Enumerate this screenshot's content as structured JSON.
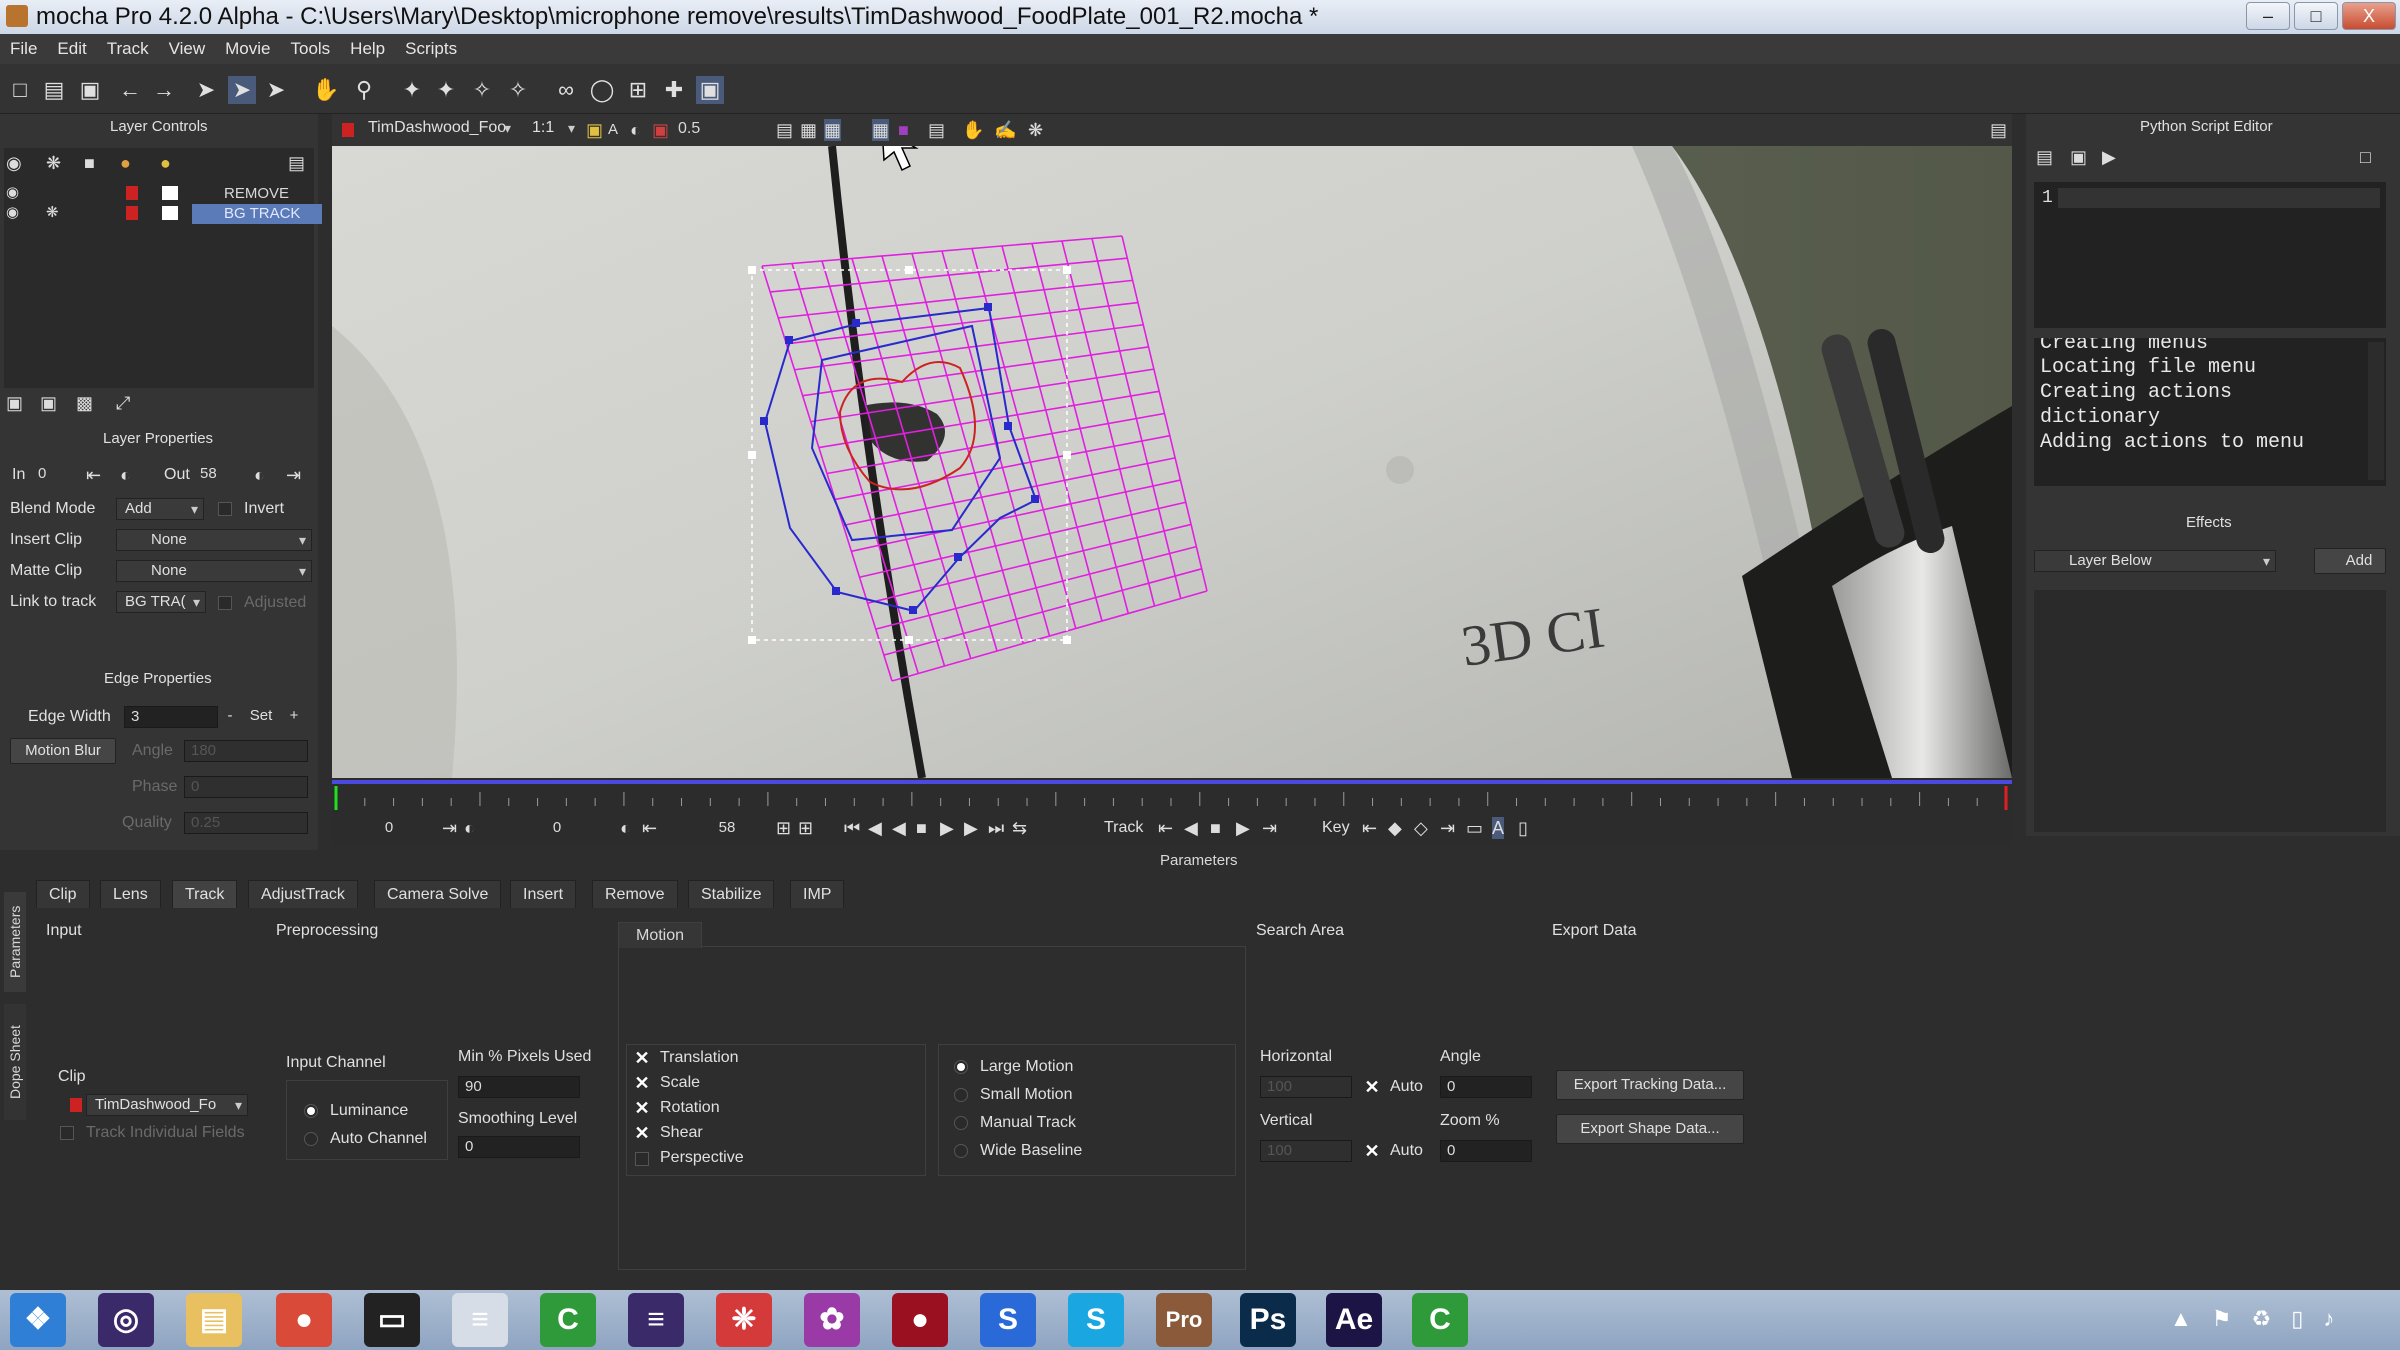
{
  "window": {
    "title": "mocha Pro 4.2.0 Alpha - C:\\Users\\Mary\\Desktop\\microphone remove\\results\\TimDashwood_FoodPlate_001_R2.mocha *",
    "minimize": "–",
    "maximize": "□",
    "close": "X"
  },
  "menu": [
    "File",
    "Edit",
    "Track",
    "View",
    "Movie",
    "Tools",
    "Help",
    "Scripts"
  ],
  "layer_controls": {
    "title": "Layer Controls",
    "layers": [
      {
        "name": "REMOVE",
        "selected": false
      },
      {
        "name": "BG TRACK",
        "selected": true
      }
    ]
  },
  "layer_properties": {
    "title": "Layer Properties",
    "in_label": "In",
    "in_value": "0",
    "out_label": "Out",
    "out_value": "58",
    "blend_mode_label": "Blend Mode",
    "blend_mode_value": "Add",
    "invert_label": "Invert",
    "insert_clip_label": "Insert Clip",
    "insert_clip_value": "None",
    "matte_clip_label": "Matte Clip",
    "matte_clip_value": "None",
    "link_to_track_label": "Link to track",
    "link_to_track_value": "BG TRA(",
    "adjusted_label": "Adjusted"
  },
  "edge_properties": {
    "title": "Edge Properties",
    "edge_width_label": "Edge Width",
    "edge_width_value": "3",
    "minus": "-",
    "set": "Set",
    "plus": "+",
    "motion_blur": "Motion Blur",
    "angle_label": "Angle",
    "angle_value": "180",
    "phase_label": "Phase",
    "phase_value": "0",
    "quality_label": "Quality",
    "quality_value": "0.25"
  },
  "viewer": {
    "clip_name": "TimDashwood_Foo",
    "zoom": "1:1",
    "opacity": "0.5",
    "shirt_text": "3D CI"
  },
  "timeline": {
    "start": "0",
    "current": "0",
    "end": "58",
    "track_label": "Track",
    "key_label": "Key"
  },
  "python_editor": {
    "title": "Python Script Editor",
    "line_number": "1",
    "console_lines": [
      "Creating menus",
      "Locating file menu",
      "Creating actions",
      "dictionary",
      "Adding actions to menu"
    ]
  },
  "effects": {
    "title": "Effects",
    "layer_value": "Layer Below",
    "add": "Add"
  },
  "parameters": {
    "title": "Parameters",
    "side_tabs": [
      "Parameters",
      "Dope Sheet"
    ],
    "tabs": [
      "Clip",
      "Lens",
      "Track",
      "AdjustTrack",
      "Camera Solve",
      "Insert",
      "Remove",
      "Stabilize",
      "IMP"
    ],
    "active_tab": "Track",
    "input": {
      "title": "Input",
      "clip_label": "Clip",
      "clip_value": "TimDashwood_Fo",
      "track_individual_fields": "Track Individual Fields"
    },
    "preprocessing": {
      "title": "Preprocessing",
      "input_channel_label": "Input Channel",
      "luminance": "Luminance",
      "auto_channel": "Auto Channel",
      "min_pixels_label": "Min % Pixels Used",
      "min_pixels_value": "90",
      "smoothing_label": "Smoothing Level",
      "smoothing_value": "0"
    },
    "motion": {
      "title": "Motion",
      "options": [
        {
          "label": "Translation",
          "checked": true
        },
        {
          "label": "Scale",
          "checked": true
        },
        {
          "label": "Rotation",
          "checked": true
        },
        {
          "label": "Shear",
          "checked": true
        },
        {
          "label": "Perspective",
          "checked": false
        }
      ],
      "modes": [
        {
          "label": "Large Motion",
          "selected": true
        },
        {
          "label": "Small Motion",
          "selected": false
        },
        {
          "label": "Manual Track",
          "selected": false
        },
        {
          "label": "Wide Baseline",
          "selected": false
        }
      ]
    },
    "search_area": {
      "title": "Search Area",
      "horizontal_label": "Horizontal",
      "horizontal_value": "100",
      "vertical_label": "Vertical",
      "vertical_value": "100",
      "auto_label": "Auto",
      "angle_label": "Angle",
      "angle_value": "0",
      "zoom_label": "Zoom %",
      "zoom_value": "0"
    },
    "export_data": {
      "title": "Export Data",
      "export_tracking": "Export Tracking Data...",
      "export_shape": "Export Shape Data..."
    }
  },
  "taskbar": {
    "apps": [
      {
        "name": "start",
        "glyph": "❖",
        "color": "#2f7fd6"
      },
      {
        "name": "app-viewer",
        "glyph": "◎",
        "color": "#3b2a6a"
      },
      {
        "name": "explorer",
        "glyph": "▤",
        "color": "#e8c060"
      },
      {
        "name": "chrome",
        "glyph": "●",
        "color": "#d94a38"
      },
      {
        "name": "terminal",
        "glyph": "▭",
        "color": "#222222"
      },
      {
        "name": "notepad",
        "glyph": "≡",
        "color": "#d7dde6"
      },
      {
        "name": "camtasia",
        "glyph": "C",
        "color": "#2e9a3a"
      },
      {
        "name": "premiere",
        "glyph": "≡",
        "color": "#3a2a6a"
      },
      {
        "name": "davinci",
        "glyph": "❈",
        "color": "#d53a3a"
      },
      {
        "name": "motion",
        "glyph": "✿",
        "color": "#9a3aa6"
      },
      {
        "name": "obs",
        "glyph": "●",
        "color": "#9a1020"
      },
      {
        "name": "sketchbook",
        "glyph": "S",
        "color": "#2a6ad8"
      },
      {
        "name": "skype",
        "glyph": "S",
        "color": "#1aa6e0"
      },
      {
        "name": "mocha",
        "glyph": "Pro",
        "color": "#8a5a3a"
      },
      {
        "name": "photoshop",
        "glyph": "Ps",
        "color": "#0a2b4a"
      },
      {
        "name": "after-effects",
        "glyph": "Ae",
        "color": "#1c1445"
      },
      {
        "name": "camtasia-2",
        "glyph": "C",
        "color": "#2f9a3a"
      }
    ],
    "tray": [
      "▲",
      "⚑",
      "♻",
      "▯",
      "♪"
    ]
  }
}
